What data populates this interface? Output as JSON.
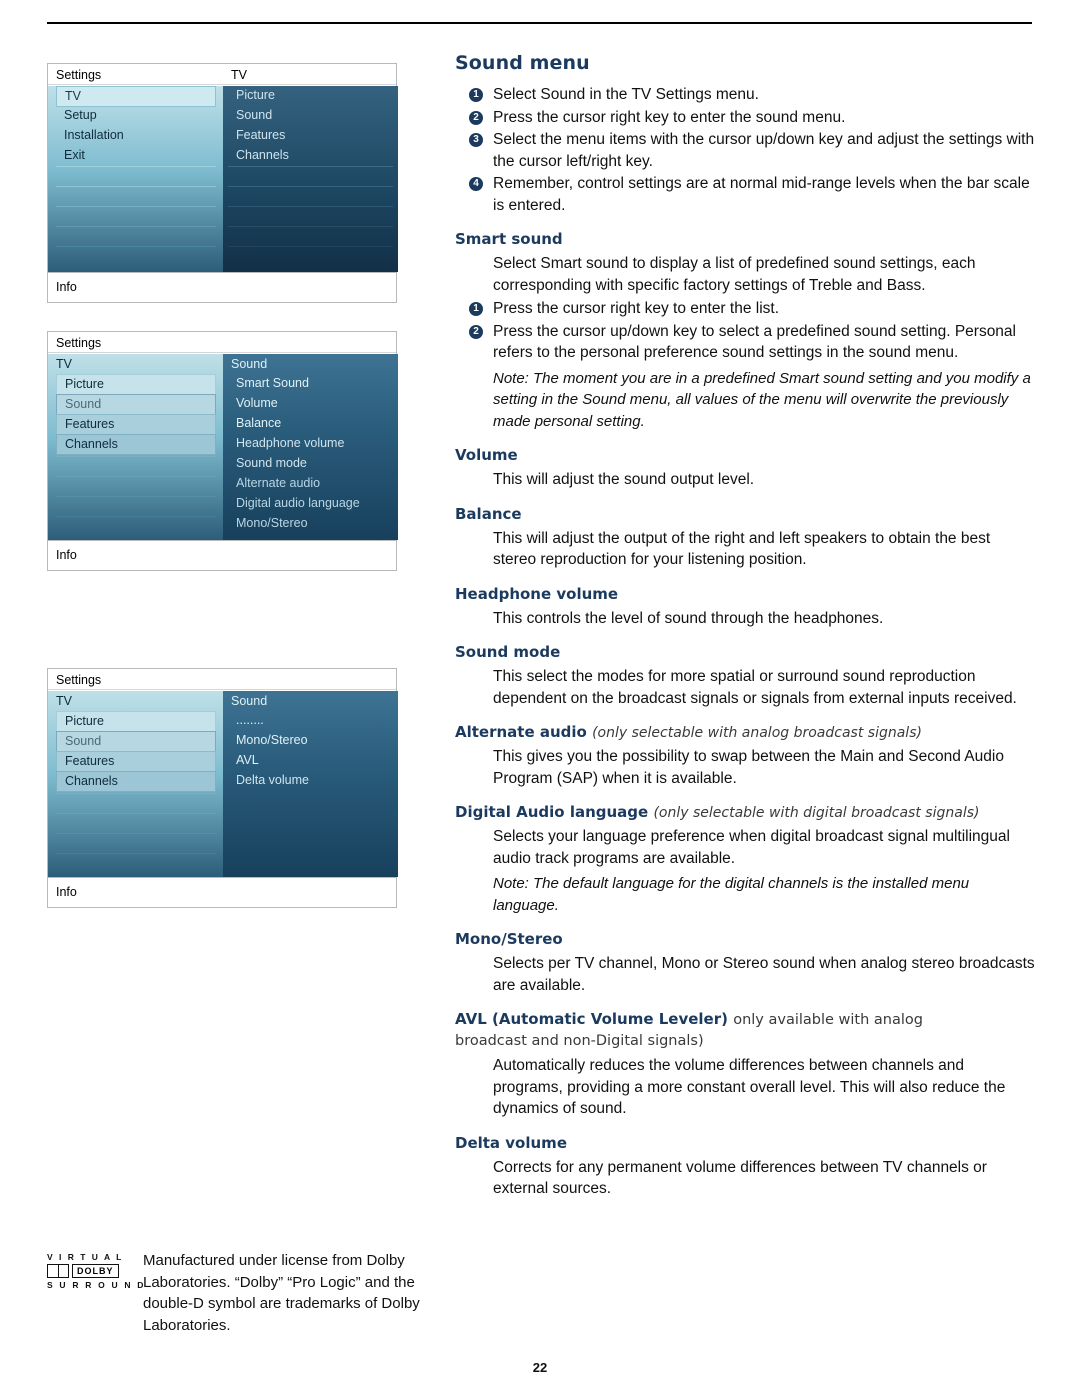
{
  "page_number": "22",
  "section": {
    "title": "Sound menu",
    "intro_steps": [
      "Select Sound in the TV Settings menu.",
      "Press the cursor right key to enter the sound menu.",
      "Select the menu items with the cursor up/down key and adjust the settings with the cursor left/right key.",
      "Remember, control settings are at normal mid-range levels when the bar scale is entered."
    ]
  },
  "topics": {
    "smart_sound": {
      "heading": "Smart sound",
      "intro": "Select Smart sound to display a list of predefined sound settings, each corresponding with specific factory settings of Treble and Bass.",
      "steps": [
        "Press the cursor right key to enter the list.",
        "Press the cursor up/down key to select a predefined sound setting. Personal refers to the personal preference sound settings in the sound menu."
      ],
      "note": "Note: The moment you are in a predefined Smart sound setting and you modify a setting in the Sound menu, all values of the menu will overwrite the previously made personal setting."
    },
    "volume": {
      "heading": "Volume",
      "body": "This will adjust the sound output level."
    },
    "balance": {
      "heading": "Balance",
      "body": "This will adjust the output of the right and left speakers to obtain the best stereo reproduction for your listening position."
    },
    "headphone_volume": {
      "heading": "Headphone volume",
      "body": "This controls the level of sound through the headphones."
    },
    "sound_mode": {
      "heading": "Sound mode",
      "body": "This select the modes for more spatial or surround sound reproduction dependent on the broadcast signals or signals from external inputs received."
    },
    "alternate_audio": {
      "heading": "Alternate audio",
      "heading_note": "(only selectable with analog broadcast signals)",
      "body": "This gives you the possibility to swap between the Main and Second Audio Program (SAP) when it is available."
    },
    "digital_audio_language": {
      "heading": "Digital Audio language",
      "heading_note": "(only selectable with digital broadcast signals)",
      "body": "Selects your language preference when digital broadcast signal multilingual audio track programs are available.",
      "note": "Note: The default language for the digital channels is the installed menu language."
    },
    "mono_stereo": {
      "heading": "Mono/Stereo",
      "body": "Selects per TV channel, Mono or Stereo sound when analog stereo broadcasts are available."
    },
    "avl": {
      "heading": "AVL (Automatic Volume Leveler)",
      "heading_note": "only available with analog",
      "heading_note2": "broadcast and non-Digital signals)",
      "body": "Automatically reduces the volume differences between channels and programs, providing a more constant overall level. This will also reduce the dynamics of sound."
    },
    "delta_volume": {
      "heading": "Delta volume",
      "body": "Corrects for any permanent volume differences between TV channels or external sources."
    }
  },
  "menus": {
    "menu1": {
      "left_header": "Settings",
      "right_header": "TV",
      "left_items": [
        "TV",
        "Setup",
        "Installation",
        "Exit"
      ],
      "right_items": [
        "Picture",
        "Sound",
        "Features",
        "Channels"
      ],
      "left_selected_index": 0,
      "info_label": "Info"
    },
    "menu2": {
      "top_header": "Settings",
      "left_header": "TV",
      "right_header": "Sound",
      "left_items": [
        "Picture",
        "Sound",
        "Features",
        "Channels"
      ],
      "right_items": [
        "Smart Sound",
        "Volume",
        "Balance",
        "Headphone volume",
        "Sound mode",
        "Alternate audio",
        "Digital audio language",
        "Mono/Stereo"
      ],
      "left_selected_index": 1,
      "info_label": "Info"
    },
    "menu3": {
      "top_header": "Settings",
      "left_header": "TV",
      "right_header": "Sound",
      "left_items": [
        "Picture",
        "Sound",
        "Features",
        "Channels"
      ],
      "right_items": [
        "........",
        "Mono/Stereo",
        "AVL",
        "Delta volume"
      ],
      "left_selected_index": 1,
      "info_label": "Info"
    }
  },
  "dolby": {
    "virtual": "V I R T U A L",
    "brand": "DOLBY",
    "surround": "S U R R O U N D",
    "text": "Manufactured under license from Dolby Laboratories. “Dolby” “Pro Logic” and the double-D symbol are trademarks of Dolby Laboratories."
  }
}
